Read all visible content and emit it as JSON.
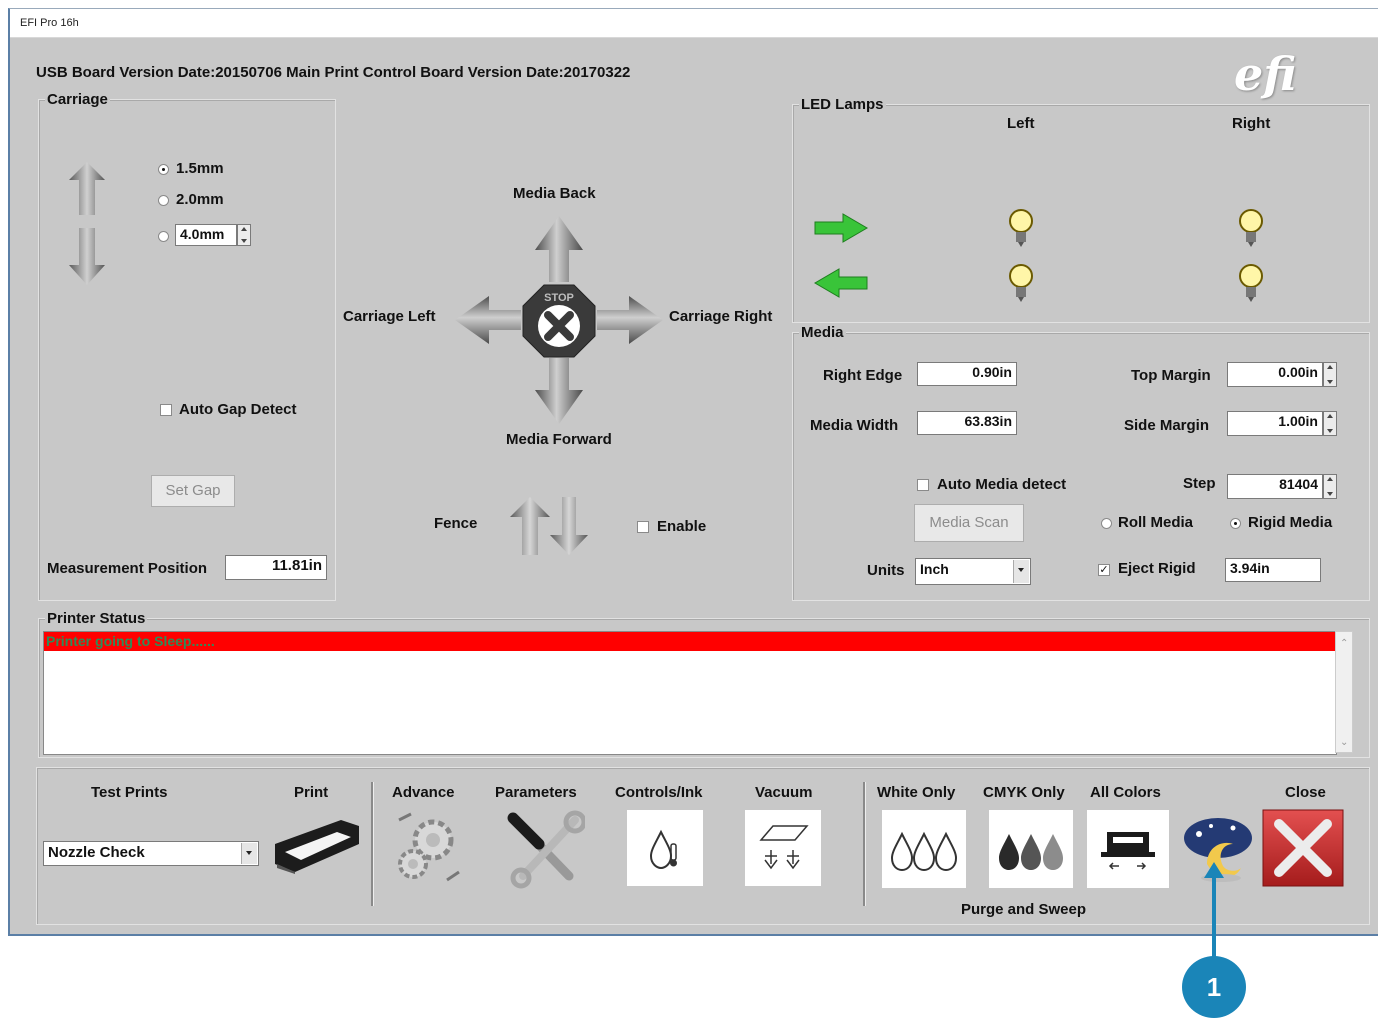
{
  "window": {
    "title": "EFI Pro 16h"
  },
  "header": {
    "version_text": "USB Board Version Date:20150706  Main Print Control Board Version Date:20170322",
    "logo": "efi"
  },
  "carriage": {
    "legend": "Carriage",
    "options": [
      "1.5mm",
      "2.0mm"
    ],
    "custom_value": "4.0mm",
    "selected": "1.5mm",
    "auto_gap_label": "Auto Gap Detect",
    "set_gap_label": "Set Gap",
    "measurement_label": "Measurement Position",
    "measurement_value": "11.81in"
  },
  "movement": {
    "media_back": "Media Back",
    "media_forward": "Media Forward",
    "carriage_left": "Carriage Left",
    "carriage_right": "Carriage Right",
    "stop_text": "STOP",
    "fence_label": "Fence",
    "enable_label": "Enable"
  },
  "led": {
    "legend": "LED Lamps",
    "left_label": "Left",
    "right_label": "Right"
  },
  "media": {
    "legend": "Media",
    "right_edge_label": "Right Edge",
    "right_edge_value": "0.90in",
    "media_width_label": "Media Width",
    "media_width_value": "63.83in",
    "top_margin_label": "Top Margin",
    "top_margin_value": "0.00in",
    "side_margin_label": "Side Margin",
    "side_margin_value": "1.00in",
    "auto_media_label": "Auto Media detect",
    "step_label": "Step",
    "step_value": "81404",
    "media_scan_label": "Media Scan",
    "roll_media_label": "Roll Media",
    "rigid_media_label": "Rigid Media",
    "selected_media": "Rigid Media",
    "units_label": "Units",
    "units_value": "Inch",
    "eject_rigid_label": "Eject Rigid",
    "eject_rigid_checked": true,
    "eject_rigid_value": "3.94in"
  },
  "status": {
    "legend": "Printer Status",
    "message": "Printer going to Sleep......",
    "highlight_color": "#ff0000",
    "message_color": "#2e8b57"
  },
  "toolbar": {
    "test_prints_label": "Test Prints",
    "print_label": "Print",
    "test_prints_value": "Nozzle Check",
    "advance_label": "Advance",
    "parameters_label": "Parameters",
    "controls_label": "Controls/Ink",
    "vacuum_label": "Vacuum",
    "white_only_label": "White Only",
    "cmyk_only_label": "CMYK Only",
    "all_colors_label": "All Colors",
    "close_label": "Close",
    "purge_label": "Purge and Sweep"
  },
  "callout": {
    "number": "1",
    "color": "#1a85b8"
  }
}
